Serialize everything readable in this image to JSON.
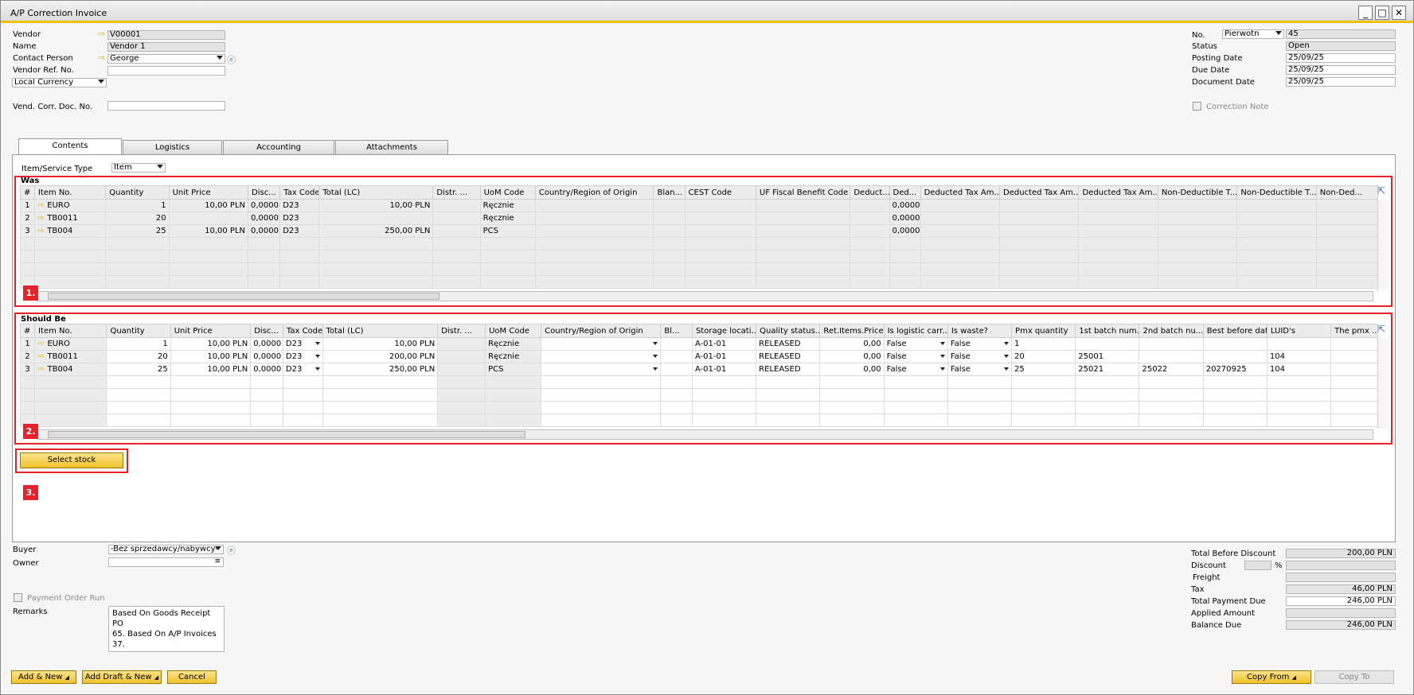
{
  "window": {
    "title": "A/P Correction Invoice"
  },
  "header": {
    "vendor_label": "Vendor",
    "vendor_value": "V00001",
    "name_label": "Name",
    "name_value": "Vendor 1",
    "contact_label": "Contact Person",
    "contact_value": "George",
    "vendor_ref_label": "Vendor Ref. No.",
    "vendor_ref_value": "",
    "currency_value": "Local Currency",
    "corr_doc_label": "Vend. Corr. Doc. No.",
    "corr_doc_value": "",
    "no_label": "No.",
    "no_series": "Pierwotn",
    "no_value": "45",
    "status_label": "Status",
    "status_value": "Open",
    "posting_label": "Posting Date",
    "posting_value": "25/09/25",
    "due_label": "Due Date",
    "due_value": "25/09/25",
    "document_label": "Document Date",
    "document_value": "25/09/25",
    "correction_note_label": "Correction Note"
  },
  "tabs": [
    "Contents",
    "Logistics",
    "Accounting",
    "Attachments"
  ],
  "item_type_label": "Item/Service Type",
  "item_type_value": "Item",
  "was": {
    "title": "Was",
    "columns": [
      "#",
      "Item No.",
      "Quantity",
      "Unit Price",
      "Disc...",
      "Tax Code",
      "Total (LC)",
      "Distr. ...",
      "UoM Code",
      "Country/Region of Origin",
      "Blan...",
      "CEST Code",
      "UF Fiscal Benefit Code",
      "Deduct...",
      "Ded...",
      "Deducted Tax Am...",
      "Deducted Tax Am...",
      "Deducted Tax Am...",
      "Non-Deductible T...",
      "Non-Deductible T...",
      "Non-Ded..."
    ],
    "rows": [
      [
        "1",
        "EURO",
        "1",
        "10,00 PLN",
        "0,0000",
        "D23",
        "10,00 PLN",
        "",
        "Ręcznie",
        "",
        "",
        "",
        "",
        "",
        "0,000000",
        "",
        "",
        "",
        "",
        "",
        ""
      ],
      [
        "2",
        "TB0011",
        "20",
        "",
        "0,0000",
        "D23",
        "",
        "",
        "Ręcznie",
        "",
        "",
        "",
        "",
        "",
        "0,000000",
        "",
        "",
        "",
        "",
        "",
        ""
      ],
      [
        "3",
        "TB004",
        "25",
        "10,00 PLN",
        "0,0000",
        "D23",
        "250,00 PLN",
        "",
        "PCS",
        "",
        "",
        "",
        "",
        "",
        "0,000000",
        "",
        "",
        "",
        "",
        "",
        ""
      ]
    ],
    "badge": "1."
  },
  "should_be": {
    "title": "Should Be",
    "columns": [
      "#",
      "Item No.",
      "Quantity",
      "Unit Price",
      "Disc...",
      "Tax Code",
      "Total (LC)",
      "Distr. ...",
      "UoM Code",
      "Country/Region of Origin",
      "Bl...",
      "Storage locati...",
      "Quality status...",
      "Ret.Items.Price",
      "Is logistic carr...",
      "Is waste?",
      "Pmx quantity",
      "1st batch num...",
      "2nd batch nu...",
      "Best before date",
      "LUID's",
      "The pmx ..."
    ],
    "rows": [
      [
        "1",
        "EURO",
        "1",
        "10,00 PLN",
        "0,0000",
        "D23",
        "10,00 PLN",
        "",
        "Ręcznie",
        "",
        "",
        "A-01-01",
        "RELEASED",
        "0,00",
        "False",
        "False",
        "1",
        "",
        "",
        "",
        "",
        ""
      ],
      [
        "2",
        "TB0011",
        "20",
        "10,00 PLN",
        "0,0000",
        "D23",
        "200,00 PLN",
        "",
        "Ręcznie",
        "",
        "",
        "A-01-01",
        "RELEASED",
        "0,00",
        "False",
        "False",
        "20",
        "25001",
        "",
        "",
        "104",
        ""
      ],
      [
        "3",
        "TB004",
        "25",
        "10,00 PLN",
        "0,0000",
        "D23",
        "250,00 PLN",
        "",
        "PCS",
        "",
        "",
        "A-01-01",
        "RELEASED",
        "0,00",
        "False",
        "False",
        "25",
        "25021",
        "25022",
        "20270925",
        "104",
        ""
      ]
    ],
    "badge": "2."
  },
  "select_stock": {
    "label": "Select stock",
    "badge": "3."
  },
  "footer": {
    "buyer_label": "Buyer",
    "buyer_value": "-Bez sprzedawcy/nabywcy-",
    "owner_label": "Owner",
    "owner_value": "",
    "payment_order_label": "Payment Order Run",
    "remarks_label": "Remarks",
    "remarks_line1": "Based On Goods Receipt PO",
    "remarks_line2": "65. Based On A/P Invoices 37.",
    "total_before_label": "Total Before Discount",
    "total_before_value": "200,00 PLN",
    "discount_label": "Discount",
    "discount_pct": "%",
    "freight_label": "Freight",
    "tax_label": "Tax",
    "tax_value": "46,00 PLN",
    "total_due_label": "Total Payment Due",
    "total_due_value": "246,00 PLN",
    "applied_label": "Applied Amount",
    "applied_value": "",
    "balance_label": "Balance Due",
    "balance_value": "246,00 PLN"
  },
  "buttons": {
    "add_new": "Add & New",
    "add_draft": "Add Draft & New",
    "cancel": "Cancel",
    "copy_from": "Copy From",
    "copy_to": "Copy To"
  }
}
